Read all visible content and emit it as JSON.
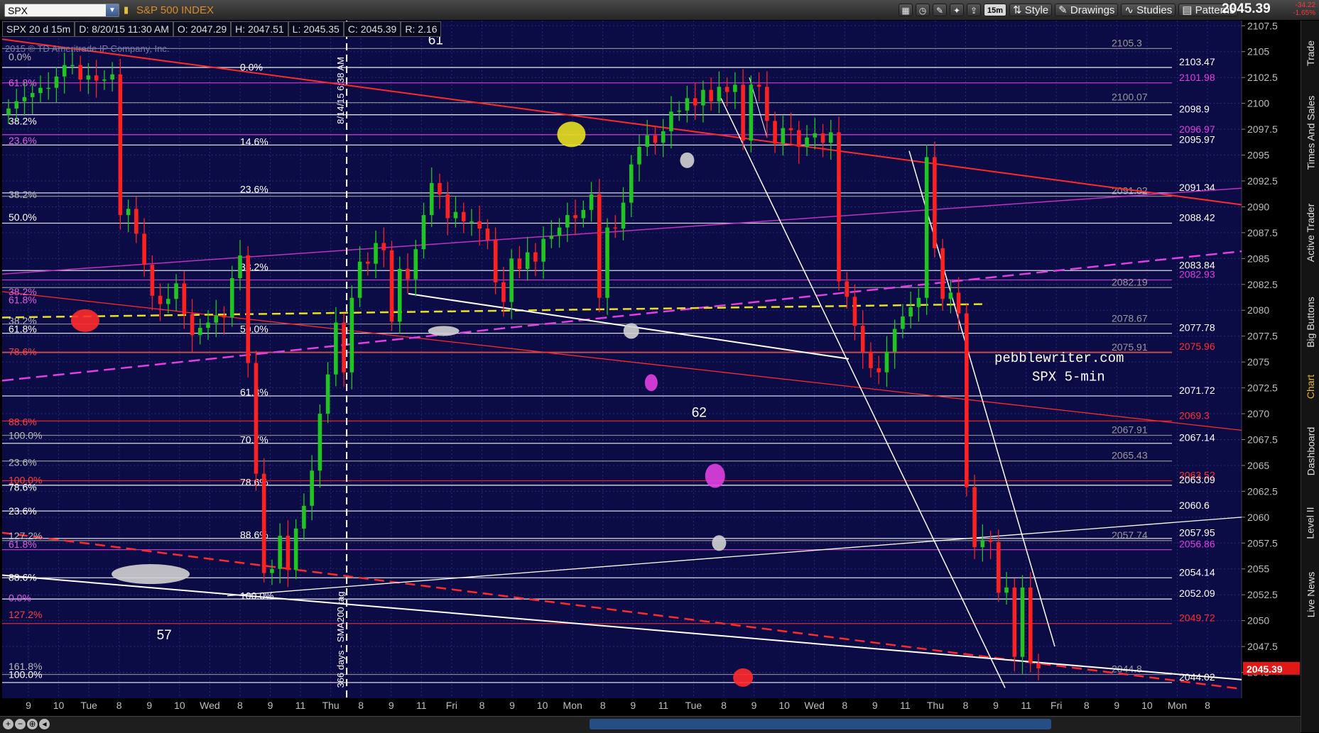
{
  "window": {
    "symbol": "SPX",
    "symbol_name": "S&P 500 INDEX",
    "timeframe_button": "15m",
    "toolbar": [
      "Style",
      "Drawings",
      "Studies",
      "Patterns"
    ],
    "last_price": "2045.39",
    "change": "-34.22",
    "change_pct": "-1.65%",
    "sidebar_tabs": [
      "Trade",
      "Times And Sales",
      "Active Trader",
      "Big Buttons",
      "Chart",
      "Dashboard",
      "Level II",
      "Live News"
    ],
    "active_tab": "Chart"
  },
  "header": {
    "study": "SPX 20 d 15m",
    "date": "D: 8/20/15 11:30 AM",
    "open": "O: 2047.29",
    "high": "H: 2047.51",
    "low": "L: 2045.35",
    "close": "C: 2045.39",
    "range": "R: 2.16",
    "copyright": "2015 © TD Ameritrade IP Company, Inc."
  },
  "colors": {
    "background": "#0b0b45",
    "grid": "#2a2a7a",
    "up_candle": "#21c521",
    "down_candle": "#ff2020",
    "axis_text": "#bfbfbf",
    "last_badge": "#e01818"
  },
  "chart_data": {
    "type": "candlestick",
    "title": "",
    "watermark": [
      "pebblewriter.com",
      "SPX 5-min"
    ],
    "ylim": [
      2042.5,
      2108
    ],
    "ytick_values": [
      2045,
      2047.5,
      2050,
      2052.5,
      2055,
      2057.5,
      2060,
      2062.5,
      2065,
      2067.5,
      2070,
      2072.5,
      2075,
      2077.5,
      2080,
      2082.5,
      2085,
      2087.5,
      2090,
      2092.5,
      2095,
      2097.5,
      2100,
      2102.5,
      2105,
      2107.5
    ],
    "x_ticks": [
      "9",
      "10",
      "Tue",
      "8",
      "9",
      "10",
      "Wed",
      "8",
      "9",
      "11",
      "Thu",
      "8",
      "9",
      "11",
      "Fri",
      "8",
      "9",
      "10",
      "Mon",
      "8",
      "9",
      "11",
      "Tue",
      "8",
      "9",
      "10",
      "Wed",
      "8",
      "9",
      "11",
      "Thu",
      "8",
      "9",
      "11",
      "Fri",
      "8",
      "9",
      "10",
      "Mon",
      "8"
    ],
    "bar_count": 130,
    "last_price": 2045.39,
    "closes": [
      2099.5,
      2100.2,
      2100.6,
      2101.0,
      2101.5,
      2101.5,
      2102.6,
      2103.7,
      2103.7,
      2102.3,
      2102.7,
      2102.2,
      2102.3,
      2102.8,
      2089.2,
      2089.8,
      2087.4,
      2084.4,
      2081.4,
      2080.6,
      2081.1,
      2082.6,
      2079.6,
      2077.6,
      2078.3,
      2078.8,
      2079.5,
      2079.3,
      2083.1,
      2085.3,
      2074.9,
      2064.2,
      2054.6,
      2055.0,
      2058.2,
      2054.9,
      2058.9,
      2061.1,
      2064.5,
      2070.0,
      2073.8,
      2078.8,
      2074.0,
      2081.2,
      2084.7,
      2084.5,
      2086.5,
      2085.8,
      2078.9,
      2084.0,
      2083.0,
      2085.9,
      2089.2,
      2092.3,
      2091.2,
      2088.9,
      2089.5,
      2088.6,
      2088.6,
      2087.9,
      2086.8,
      2082.7,
      2080.8,
      2085.0,
      2084.0,
      2085.6,
      2084.7,
      2086.9,
      2087.2,
      2088.0,
      2089.2,
      2088.9,
      2089.7,
      2091.2,
      2081.2,
      2088.0,
      2087.9,
      2090.4,
      2094.1,
      2095.8,
      2096.9,
      2096.2,
      2097.3,
      2099.2,
      2099.3,
      2100.5,
      2099.8,
      2101.3,
      2100.2,
      2101.6,
      2101.1,
      2101.8,
      2096.4,
      2101.8,
      2101.6,
      2098.3,
      2096.1,
      2097.6,
      2097.4,
      2095.8,
      2096.7,
      2097.1,
      2096.2,
      2097.2,
      2082.8,
      2081.3,
      2078.5,
      2076.0,
      2074.4,
      2074.0,
      2076.0,
      2078.2,
      2079.4,
      2080.3,
      2081.2,
      2094.8,
      2086.0,
      2081.1,
      2081.7,
      2079.7,
      2062.9,
      2057.1,
      2057.8,
      2057.6,
      2052.7,
      2053.2,
      2046.5,
      2053.2,
      2045.9,
      2045.39
    ],
    "horizontal_levels": [
      {
        "label": "2105.3",
        "value": 2105.3,
        "color": "#999999"
      },
      {
        "label": "2103.47",
        "value": 2103.47,
        "color": "#ffffff"
      },
      {
        "label": "2101.98",
        "value": 2101.98,
        "color": "#e040e0"
      },
      {
        "label": "2100.07",
        "value": 2100.07,
        "color": "#999999"
      },
      {
        "label": "2098.9",
        "value": 2098.9,
        "color": "#ffffff"
      },
      {
        "label": "2096.97",
        "value": 2096.97,
        "color": "#e040e0"
      },
      {
        "label": "2095.97",
        "value": 2095.97,
        "color": "#ffffff"
      },
      {
        "label": "2091.02",
        "value": 2091.02,
        "color": "#999999"
      },
      {
        "label": "2091.34",
        "value": 2091.34,
        "color": "#ffffff"
      },
      {
        "label": "2088.42",
        "value": 2088.42,
        "color": "#ffffff"
      },
      {
        "label": "2083.84",
        "value": 2083.84,
        "color": "#ffffff"
      },
      {
        "label": "2082.93",
        "value": 2082.93,
        "color": "#e040e0"
      },
      {
        "label": "2082.19",
        "value": 2082.19,
        "color": "#999999"
      },
      {
        "label": "2078.67",
        "value": 2078.67,
        "color": "#999999"
      },
      {
        "label": "2077.78",
        "value": 2077.78,
        "color": "#ffffff"
      },
      {
        "label": "2075.91",
        "value": 2075.91,
        "color": "#999999"
      },
      {
        "label": "2075.96",
        "value": 2075.96,
        "color": "#ff3030"
      },
      {
        "label": "2071.72",
        "value": 2071.72,
        "color": "#ffffff"
      },
      {
        "label": "2069.3",
        "value": 2069.3,
        "color": "#ff3030"
      },
      {
        "label": "2067.91",
        "value": 2067.91,
        "color": "#999999"
      },
      {
        "label": "2067.14",
        "value": 2067.14,
        "color": "#ffffff"
      },
      {
        "label": "2065.43",
        "value": 2065.43,
        "color": "#999999"
      },
      {
        "label": "2063.52",
        "value": 2063.52,
        "color": "#ff3030"
      },
      {
        "label": "2063.09",
        "value": 2063.09,
        "color": "#ffffff"
      },
      {
        "label": "2060.6",
        "value": 2060.6,
        "color": "#ffffff"
      },
      {
        "label": "2057.95",
        "value": 2057.95,
        "color": "#ffffff"
      },
      {
        "label": "2057.74",
        "value": 2057.74,
        "color": "#999999"
      },
      {
        "label": "2056.86",
        "value": 2056.86,
        "color": "#e040e0"
      },
      {
        "label": "2054.14",
        "value": 2054.14,
        "color": "#ffffff"
      },
      {
        "label": "2052.09",
        "value": 2052.09,
        "color": "#ffffff"
      },
      {
        "label": "2049.72",
        "value": 2049.72,
        "color": "#ff3030"
      },
      {
        "label": "2044.8",
        "value": 2044.8,
        "color": "#999999"
      },
      {
        "label": "2044.02",
        "value": 2044.02,
        "color": "#ffffff"
      }
    ],
    "fib_labels": [
      {
        "text": "0.0%",
        "value": 2104.5,
        "color": "#bbbbbb",
        "group": "left"
      },
      {
        "text": "61.8%",
        "value": 2102.0,
        "color": "#e060e0",
        "group": "left"
      },
      {
        "text": "38.2%",
        "value": 2098.3,
        "color": "#ffffff",
        "group": "left"
      },
      {
        "text": "23.6%",
        "value": 2096.4,
        "color": "#e060e0",
        "group": "left"
      },
      {
        "text": "38.2%",
        "value": 2091.2,
        "color": "#bbbbbb",
        "group": "left"
      },
      {
        "text": "50.0%",
        "value": 2089.0,
        "color": "#ffffff",
        "group": "left"
      },
      {
        "text": "38.2%",
        "value": 2081.8,
        "color": "#e060e0",
        "group": "left"
      },
      {
        "text": "61.8%",
        "value": 2081.0,
        "color": "#e060e0",
        "group": "left"
      },
      {
        "text": "38.2%",
        "value": 2079.0,
        "color": "#bbbbbb",
        "group": "left"
      },
      {
        "text": "61.8%",
        "value": 2078.2,
        "color": "#ffffff",
        "group": "left"
      },
      {
        "text": "78.6%",
        "value": 2076.0,
        "color": "#ff4040",
        "group": "left"
      },
      {
        "text": "88.6%",
        "value": 2069.2,
        "color": "#ff4040",
        "group": "left"
      },
      {
        "text": "100.0%",
        "value": 2067.9,
        "color": "#bbbbbb",
        "group": "left"
      },
      {
        "text": "23.6%",
        "value": 2065.3,
        "color": "#bbbbbb",
        "group": "left"
      },
      {
        "text": "100.0%",
        "value": 2063.6,
        "color": "#ff4040",
        "group": "left"
      },
      {
        "text": "78.6%",
        "value": 2062.9,
        "color": "#ffffff",
        "group": "left"
      },
      {
        "text": "23.6%",
        "value": 2060.6,
        "color": "#ffffff",
        "group": "left"
      },
      {
        "text": "127.2%",
        "value": 2058.2,
        "color": "#bbbbbb",
        "group": "left"
      },
      {
        "text": "61.8%",
        "value": 2057.4,
        "color": "#e060e0",
        "group": "left"
      },
      {
        "text": "88.6%",
        "value": 2054.2,
        "color": "#ffffff",
        "group": "left"
      },
      {
        "text": "0.0%",
        "value": 2052.2,
        "color": "#e060e0",
        "group": "left"
      },
      {
        "text": "127.2%",
        "value": 2050.6,
        "color": "#ff4040",
        "group": "left"
      },
      {
        "text": "161.8%",
        "value": 2045.6,
        "color": "#bbbbbb",
        "group": "left"
      },
      {
        "text": "100.0%",
        "value": 2044.8,
        "color": "#ffffff",
        "group": "left"
      },
      {
        "text": "0.0%",
        "value": 2103.5,
        "color": "#ffffff",
        "group": "mid"
      },
      {
        "text": "14.6%",
        "value": 2096.3,
        "color": "#ffffff",
        "group": "mid"
      },
      {
        "text": "23.6%",
        "value": 2091.7,
        "color": "#ffffff",
        "group": "mid"
      },
      {
        "text": "38.2%",
        "value": 2084.2,
        "color": "#ffffff",
        "group": "mid"
      },
      {
        "text": "50.0%",
        "value": 2078.2,
        "color": "#ffffff",
        "group": "mid"
      },
      {
        "text": "61.8%",
        "value": 2072.1,
        "color": "#ffffff",
        "group": "mid"
      },
      {
        "text": "70.7%",
        "value": 2067.5,
        "color": "#ffffff",
        "group": "mid"
      },
      {
        "text": "78.6%",
        "value": 2063.4,
        "color": "#ffffff",
        "group": "mid"
      },
      {
        "text": "88.6%",
        "value": 2058.3,
        "color": "#ffffff",
        "group": "mid"
      },
      {
        "text": "100.0%",
        "value": 2052.4,
        "color": "#ffffff",
        "group": "mid"
      }
    ],
    "annotations": [
      {
        "text": "61",
        "x_bar": 53.5,
        "value": 2105.7
      },
      {
        "text": "57",
        "x_bar": 19.5,
        "value": 2048.2
      },
      {
        "text": "62",
        "x_bar": 86.5,
        "value": 2069.7
      }
    ],
    "vertical_markers": [
      {
        "text": "8/14/15 6:38 AM",
        "x_bar": 42,
        "anchor": "top"
      },
      {
        "text": "366 days - SMA200 tag",
        "x_bar": 42,
        "anchor": "bottom"
      }
    ]
  }
}
